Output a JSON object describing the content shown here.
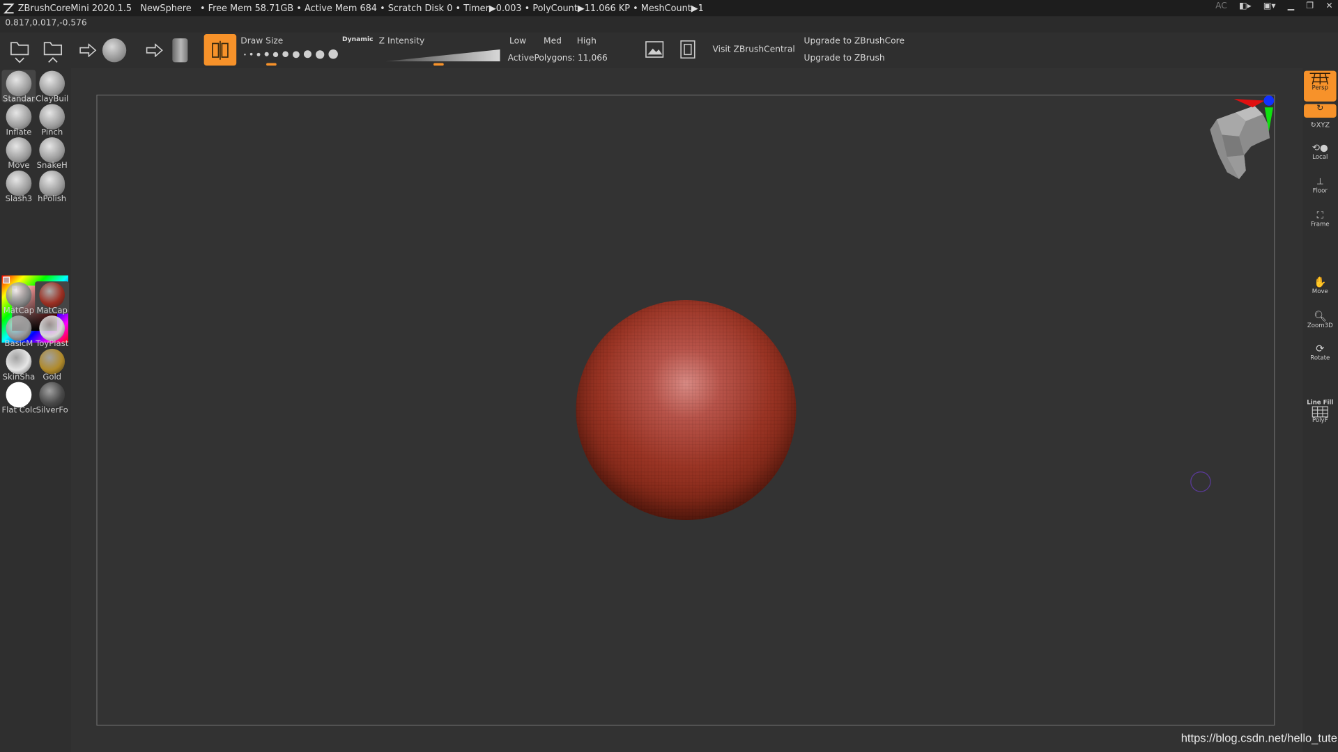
{
  "titlebar": {
    "app": "ZBrushCoreMini 2020.1.5",
    "document": "NewSphere",
    "stats": "• Free Mem 58.71GB • Active Mem 684 • Scratch Disk 0 •  Timer▶0.003 • PolyCount▶11.066 KP  • MeshCount▶1",
    "ac": "AC"
  },
  "coords": "0.817,0.017,-0.576",
  "shelf": {
    "draw_size_label": "Draw Size",
    "dynamic_label": "Dynamic",
    "z_intensity_label": "Z Intensity",
    "draw_size_level": 0.33,
    "z_intensity_level": 0.42,
    "low": "Low",
    "med": "Med",
    "high": "High",
    "active_polygons": "ActivePolygons: 11,066",
    "visit": "Visit ZBrushCentral",
    "upgrade_core": "Upgrade to ZBrushCore",
    "upgrade_zbrush": "Upgrade to ZBrush"
  },
  "brushes": [
    {
      "label": "Standar",
      "selected": true
    },
    {
      "label": "ClayBuil",
      "selected": false
    },
    {
      "label": "Inflate",
      "selected": false
    },
    {
      "label": "Pinch",
      "selected": false
    },
    {
      "label": "Move",
      "selected": false
    },
    {
      "label": "SnakeH",
      "selected": false
    },
    {
      "label": "Slash3",
      "selected": false
    },
    {
      "label": "hPolish",
      "selected": false
    }
  ],
  "materials": [
    {
      "label": "MatCap",
      "color": "#8a8a8a",
      "selected": false
    },
    {
      "label": "MatCap",
      "color": "#9b2f22",
      "selected": true
    },
    {
      "label": "BasicM",
      "color": "#9a9a9a",
      "selected": false
    },
    {
      "label": "ToyPlast",
      "color": "#d8d8d8",
      "selected": false
    },
    {
      "label": "SkinSha",
      "color": "#e6e6e6",
      "selected": false
    },
    {
      "label": "Gold",
      "color": "#b08a2a",
      "selected": false
    },
    {
      "label": "Flat Colc",
      "color": "#ffffff",
      "selected": false
    },
    {
      "label": "SilverFo",
      "color": "#4a4a4a",
      "selected": false
    }
  ],
  "right_tray": {
    "persp": "Persp",
    "xyz": "XYZ",
    "local": "Local",
    "floor": "Floor",
    "frame": "Frame",
    "move": "Move",
    "zoom3d": "Zoom3D",
    "rotate": "Rotate",
    "line_fill": "Line Fill",
    "polyf": "PolyF"
  },
  "colors": {
    "accent": "#f7922a",
    "material": "#9b2f22"
  },
  "watermark": "https://blog.csdn.net/hello_tute"
}
